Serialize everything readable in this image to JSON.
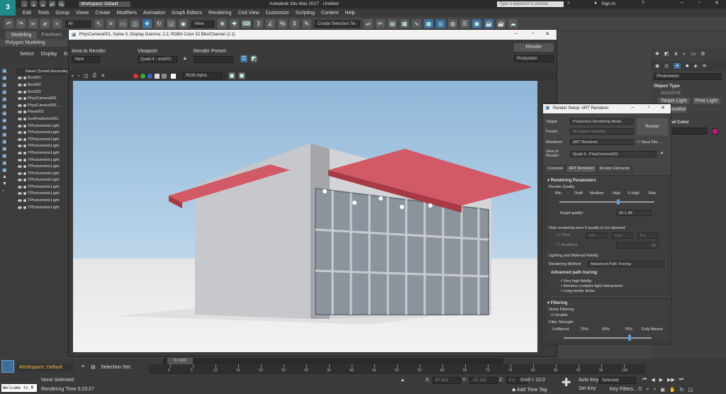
{
  "app_title": "Autodesk 3ds Max 2017 · Untitled",
  "workspace": "Workspace: Default",
  "search_placeholder": "Type a keyword or phrase",
  "sign_in": "Sign In",
  "menu": [
    "Edit",
    "Tools",
    "Group",
    "Views",
    "Create",
    "Modifiers",
    "Animation",
    "Graph Editors",
    "Rendering",
    "Civil View",
    "Customize",
    "Scripting",
    "Content",
    "Help"
  ],
  "toolbar": {
    "filter": "All",
    "ref_coord": "View",
    "selection_set": "Create Selection Se"
  },
  "ribbon": {
    "tab1": "Modeling",
    "tab2": "Freeform",
    "sub": "Polygon Modeling"
  },
  "scene_explorer": {
    "tabs": [
      "Select",
      "Display",
      "Edit"
    ],
    "header": "Name (Sorted Ascending)",
    "items": [
      "Box001",
      "Box002",
      "Box003",
      "PhysCamera001",
      "PhysCamera001...",
      "Plane001",
      "SunPositioner001",
      "TPhotometricLight",
      "TPhotometricLight",
      "TPhotometricLight",
      "TPhotometricLight",
      "TPhotometricLight",
      "TPhotometricLight",
      "TPhotometricLight",
      "TPhotometricLight",
      "TPhotometricLight",
      "TPhotometricLight",
      "TPhotometricLight",
      "TPhotometricLight",
      "TPhotometricLight"
    ]
  },
  "frame_window": {
    "title": "PhysCamera001, frame 0, Display Gamma: 2.2, RGBA Color 32 Bits/Channel (1:1)",
    "area_label": "Area to Render:",
    "area_value": "View",
    "viewport_label": "Viewport:",
    "viewport_value": "Quad 4 - era001",
    "preset_label": "Render Preset:",
    "render_btn": "Render",
    "production": "Production",
    "channel": "RGB Alpha"
  },
  "render_setup": {
    "title": "Render Setup: ART Renderer",
    "target_label": "Target:",
    "target_value": "Production Rendering Mode",
    "preset_label": "Preset:",
    "preset_value": "No preset selected",
    "renderer_label": "Renderer:",
    "renderer_value": "ART Renderer",
    "save_file": "Save File",
    "view_label": "View to Render:",
    "view_value": "Quad 4 - PhysCamera001",
    "render_btn": "Render",
    "tabs": [
      "Common",
      "ART Renderer",
      "Render Elements"
    ],
    "section1": "Rendering Parameters",
    "quality_label": "Render Quality",
    "quality_ticks": [
      "Min.",
      "Draft",
      "Medium",
      "High",
      "X-High",
      "Max."
    ],
    "quality_level": 0.62,
    "target_quality_label": "Target quality:",
    "target_quality_value": "33.1 dB",
    "stop_label": "Stop rendering even if quality is not attained:",
    "time_label": "Time:",
    "time_h": "0 h",
    "time_m": "0 m",
    "time_s": "0 s",
    "iter_label": "Iterations:",
    "iter_value": "30",
    "fidelity_label": "Lighting and Material Fidelity",
    "method_label": "Rendering Method:",
    "method_value": "Advanced Path Tracing",
    "apt_title": "Advanced path tracing:",
    "apt_bullets": [
      "Very high fidelity",
      "Renders complex light interactions",
      "Long render times"
    ],
    "section2": "Filtering",
    "noise_label": "Noise Filtering",
    "enable": "Enable",
    "strength_label": "Filter Strength:",
    "strength_ticks": [
      "Unfiltered",
      "25%",
      "50%",
      "75%",
      "Fully filtered"
    ],
    "strength_level": 0.75
  },
  "command_panel": {
    "dropdown": "Photometric",
    "rollout1": "Object Type",
    "autogrid": "AutoGrid",
    "btn_target": "Target Light",
    "btn_free": "Free Light",
    "btn_sun": "Sunpositioner",
    "rollout2": "Name and Color"
  },
  "status": {
    "workspace": "Workspace: Default",
    "selection_set": "Selection Set:",
    "none_selected": "None Selected",
    "rendering_time": "Rendering Time 0:23:27",
    "maxscript": "Welcome to M",
    "frame": "0 / 100",
    "x": "87.422",
    "y": "-37.162",
    "z": "0.0",
    "grid": "Grid = 10.0",
    "add_time_tag": "Add Time Tag",
    "auto_key": "Auto Key",
    "set_key": "Set Key",
    "selected": "Selected",
    "key_filters": "Key Filters...",
    "timeline_ticks": [
      "0",
      "5",
      "10",
      "15",
      "20",
      "25",
      "30",
      "35",
      "40",
      "45",
      "50",
      "55",
      "60",
      "65",
      "70",
      "75",
      "80",
      "85",
      "90",
      "95",
      "100"
    ]
  },
  "colors": {
    "accent": "#3d6f9a",
    "roof": "#c84a55",
    "swatch": "#c2187a"
  }
}
